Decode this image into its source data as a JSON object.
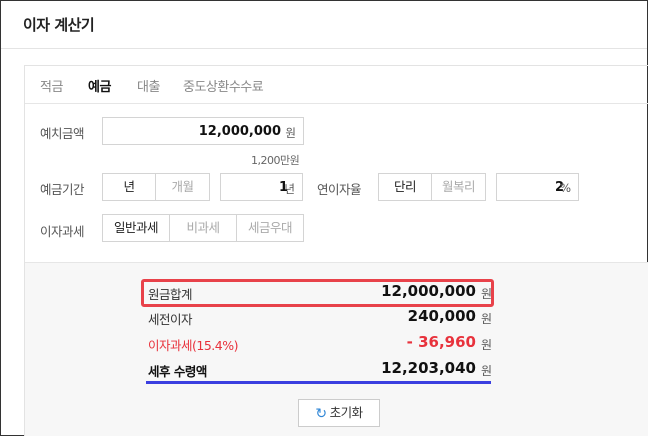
{
  "title": "이자 계산기",
  "tabs": [
    {
      "label": "적금",
      "active": false
    },
    {
      "label": "예금",
      "active": true
    },
    {
      "label": "대출",
      "active": false
    },
    {
      "label": "중도상환수수료",
      "active": false
    }
  ],
  "deposit": {
    "label": "예치금액",
    "value": "12,000,000",
    "unit": "원",
    "hint": "1,200만원"
  },
  "period": {
    "label": "예금기간",
    "options": [
      "년",
      "개월"
    ],
    "selected": "년",
    "value": "1",
    "unit": "년"
  },
  "rate": {
    "label": "연이자율",
    "options": [
      "단리",
      "월복리"
    ],
    "selected": "단리",
    "value": "2",
    "unit": "%"
  },
  "tax": {
    "label": "이자과세",
    "options": [
      "일반과세",
      "비과세",
      "세금우대"
    ],
    "selected": "일반과세"
  },
  "results": {
    "principal": {
      "label": "원금합계",
      "value": "12,000,000",
      "unit": "원"
    },
    "pretax": {
      "label": "세전이자",
      "value": "240,000",
      "unit": "원"
    },
    "taxed": {
      "label": "이자과세(15.4%)",
      "value": "- 36,960",
      "unit": "원"
    },
    "after": {
      "label": "세후 수령액",
      "value": "12,203,040",
      "unit": "원"
    }
  },
  "reset_label": "초기화",
  "colors": {
    "highlight_red": "#e8424a",
    "tax_red": "#e8323c",
    "underline_blue": "#3b3fe0",
    "reset_icon": "#2f86d6"
  }
}
